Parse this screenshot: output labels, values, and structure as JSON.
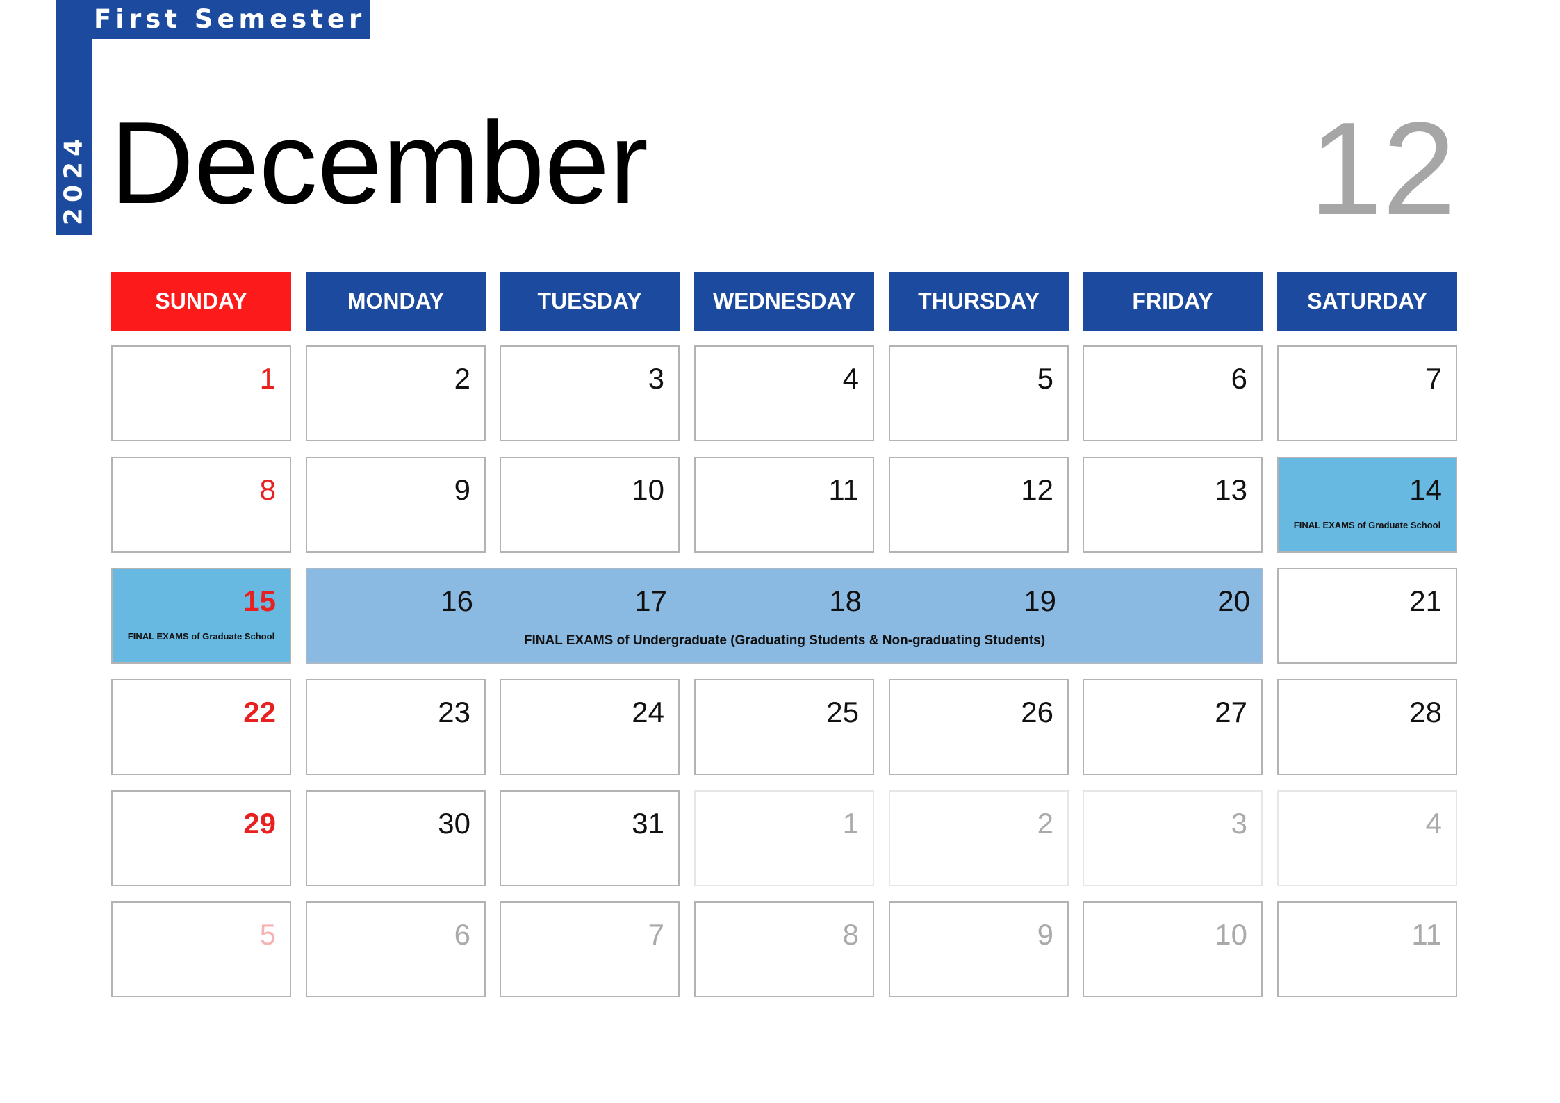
{
  "header": {
    "semester": "First Semester",
    "year": "2024",
    "month": "December",
    "month_number": "12"
  },
  "colors": {
    "blue": "#1b4a9e",
    "sunday_red": "#fd1a1a",
    "graduate_exam": "#67b9e1",
    "undergrad_exam": "#8ab9e2"
  },
  "weekdays": [
    "SUNDAY",
    "MONDAY",
    "TUESDAY",
    "WEDNESDAY",
    "THURSDAY",
    "FRIDAY",
    "SATURDAY"
  ],
  "weeks": [
    [
      "1",
      "2",
      "3",
      "4",
      "5",
      "6",
      "7"
    ],
    [
      "8",
      "9",
      "10",
      "11",
      "12",
      "13",
      "14"
    ],
    [
      "15",
      "16",
      "17",
      "18",
      "19",
      "20",
      "21"
    ],
    [
      "22",
      "23",
      "24",
      "25",
      "26",
      "27",
      "28"
    ],
    [
      "29",
      "30",
      "31",
      "1",
      "2",
      "3",
      "4"
    ],
    [
      "5",
      "6",
      "7",
      "8",
      "9",
      "10",
      "11"
    ]
  ],
  "events": {
    "graduate": "FINAL EXAMS of Graduate School",
    "undergraduate": "FINAL EXAMS of Undergraduate (Graduating Students & Non-graduating Students)"
  }
}
